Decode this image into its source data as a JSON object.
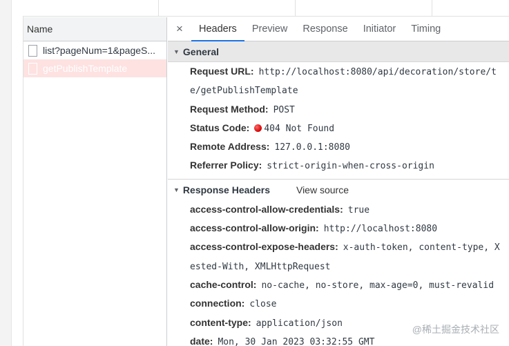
{
  "name_panel": {
    "header": "Name",
    "requests": [
      {
        "label": "list?pageNum=1&pageS...",
        "selected": false
      },
      {
        "label": "getPublishTemplate",
        "selected": true
      }
    ]
  },
  "tabs": {
    "close": "×",
    "items": [
      "Headers",
      "Preview",
      "Response",
      "Initiator",
      "Timing"
    ],
    "active": "Headers"
  },
  "general": {
    "title": "General",
    "rows": [
      {
        "key": "Request URL:",
        "value": "http://localhost:8080/api/decoration/store/t"
      },
      {
        "key": "",
        "value": "e/getPublishTemplate"
      },
      {
        "key": "Request Method:",
        "value": "POST"
      },
      {
        "key": "Status Code:",
        "value": "404 Not Found",
        "status_color": "#d40000"
      },
      {
        "key": "Remote Address:",
        "value": "127.0.0.1:8080"
      },
      {
        "key": "Referrer Policy:",
        "value": "strict-origin-when-cross-origin"
      }
    ]
  },
  "response_headers": {
    "title": "Response Headers",
    "view_source": "View source",
    "rows": [
      {
        "key": "access-control-allow-credentials:",
        "value": "true"
      },
      {
        "key": "access-control-allow-origin:",
        "value": "http://localhost:8080"
      },
      {
        "key": "access-control-expose-headers:",
        "value": "x-auth-token, content-type, X"
      },
      {
        "key": "",
        "value": "ested-With, XMLHttpRequest"
      },
      {
        "key": "cache-control:",
        "value": "no-cache, no-store, max-age=0, must-revalid"
      },
      {
        "key": "connection:",
        "value": "close"
      },
      {
        "key": "content-type:",
        "value": "application/json"
      },
      {
        "key": "date:",
        "value": "Mon, 30 Jan 2023 03:32:55 GMT"
      }
    ]
  },
  "watermark": "@稀土掘金技术社区"
}
